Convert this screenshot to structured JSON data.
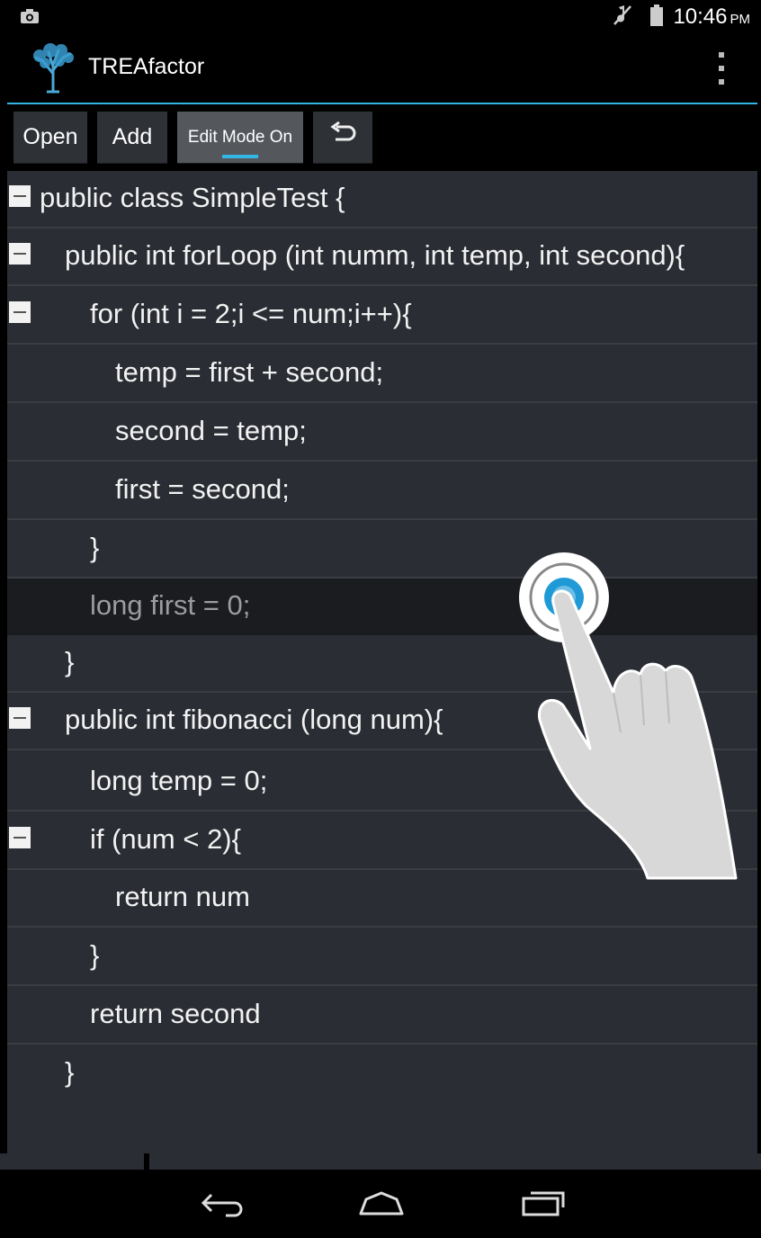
{
  "status_bar": {
    "time": "10:46",
    "ampm": "PM",
    "icons": [
      "camera-icon",
      "mute-icon",
      "battery-icon"
    ]
  },
  "action_bar": {
    "title": "TREAfactor",
    "logo_icon": "tree-logo-icon",
    "menu_icon": "overflow-menu-icon"
  },
  "toolbar": {
    "open_label": "Open",
    "add_label": "Add",
    "edit_mode_label": "Edit Mode On",
    "undo_icon": "undo-icon"
  },
  "code_lines": [
    {
      "text": "public class SimpleTest {",
      "collapsible": true
    },
    {
      "text": "public int forLoop (int numm, int temp, int second){",
      "collapsible": true
    },
    {
      "text": "for (int i = 2;i <= num;i++){",
      "collapsible": true
    },
    {
      "text": "temp = first + second;",
      "collapsible": false
    },
    {
      "text": "second = temp;",
      "collapsible": false
    },
    {
      "text": "first = second;",
      "collapsible": false
    },
    {
      "text": "}",
      "collapsible": false
    },
    {
      "text": "long first = 0;",
      "collapsible": false,
      "selected": true
    },
    {
      "text": "}",
      "collapsible": false
    },
    {
      "text": "public int fibonacci (long num){",
      "collapsible": true
    },
    {
      "text": "long temp = 0;",
      "collapsible": false
    },
    {
      "text": "if (num < 2){",
      "collapsible": true
    },
    {
      "text": "return num",
      "collapsible": false
    },
    {
      "text": "}",
      "collapsible": false
    },
    {
      "text": "return second",
      "collapsible": false
    },
    {
      "text": "}",
      "collapsible": false
    }
  ],
  "nav_bar": {
    "back_icon": "back-icon",
    "home_icon": "home-icon",
    "recents_icon": "recents-icon"
  },
  "colors": {
    "accent": "#33b5e5",
    "code_bg": "#2a2d33",
    "selected_row_bg": "#1a1c20"
  }
}
